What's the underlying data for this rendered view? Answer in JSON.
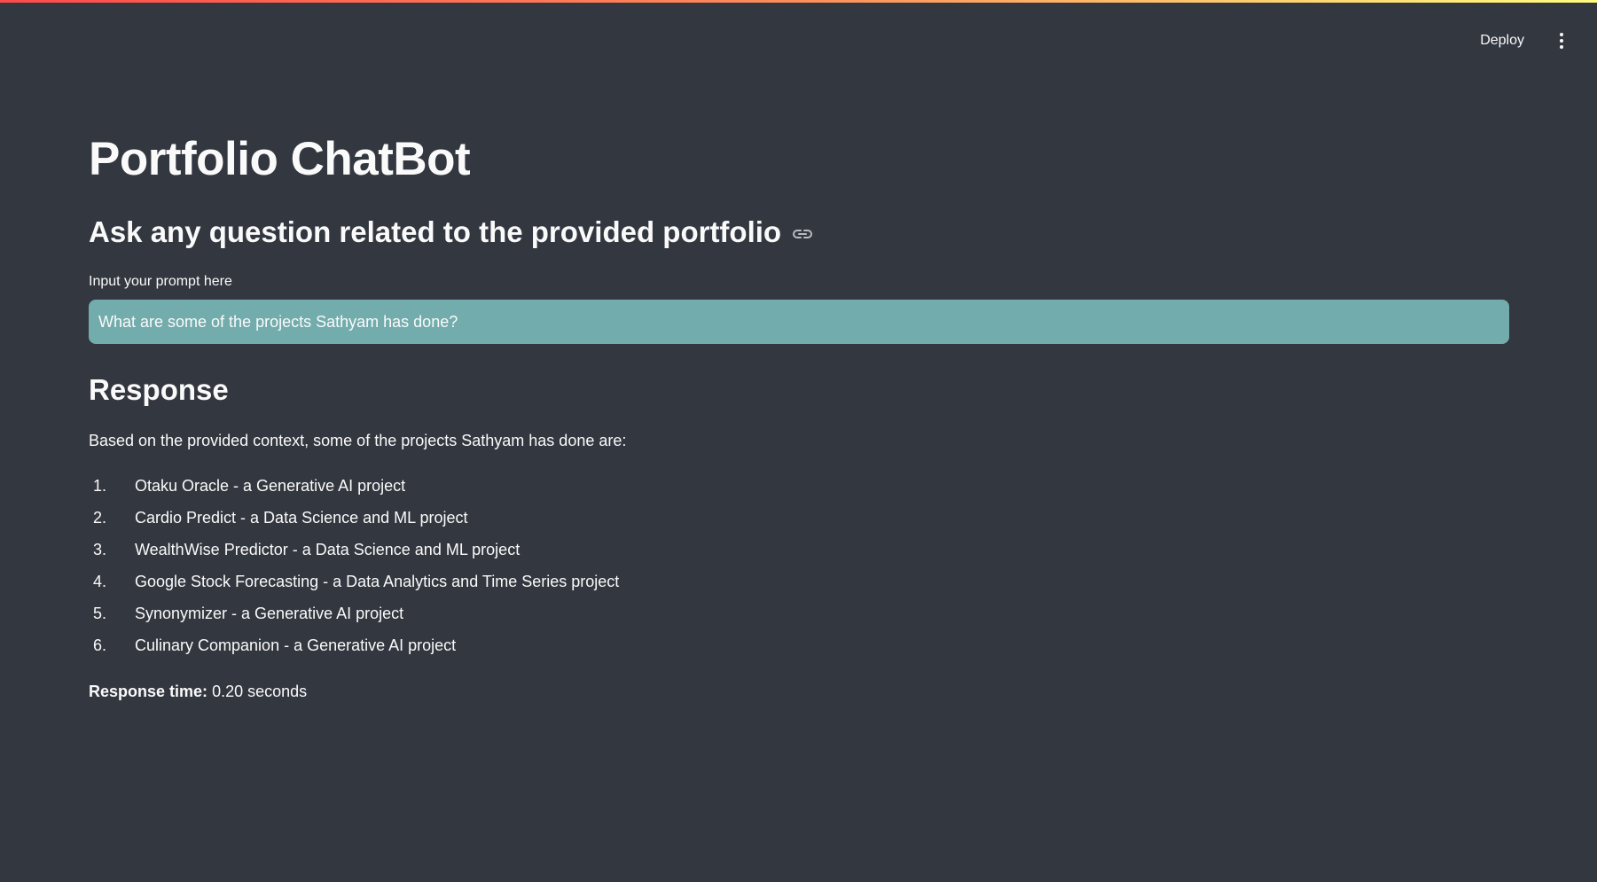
{
  "header": {
    "deploy_label": "Deploy",
    "menu_icon": "more-vertical-icon"
  },
  "main": {
    "title": "Portfolio ChatBot",
    "subtitle": "Ask any question related to the provided portfolio",
    "subtitle_icon": "link-icon",
    "input_label": "Input your prompt here",
    "input_value": "What are some of the projects Sathyam has done?",
    "response_heading": "Response",
    "response_intro": "Based on the provided context, some of the projects Sathyam has done are:",
    "projects": [
      {
        "num": "1.",
        "text": "Otaku Oracle - a Generative AI project"
      },
      {
        "num": "2.",
        "text": "Cardio Predict - a Data Science and ML project"
      },
      {
        "num": "3.",
        "text": "WealthWise Predictor - a Data Science and ML project"
      },
      {
        "num": "4.",
        "text": "Google Stock Forecasting - a Data Analytics and Time Series project"
      },
      {
        "num": "5.",
        "text": "Synonymizer - a Generative AI project"
      },
      {
        "num": "6.",
        "text": "Culinary Companion - a Generative AI project"
      }
    ],
    "response_time_label": "Response time:",
    "response_time_value": "0.20 seconds"
  },
  "colors": {
    "background": "#333740",
    "input_background": "#73acad",
    "text": "#fafafa"
  }
}
